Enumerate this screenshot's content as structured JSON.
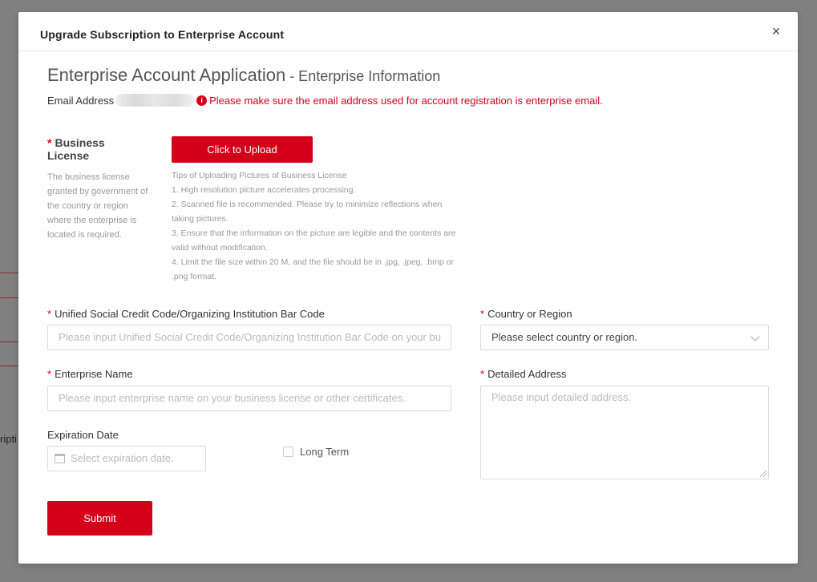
{
  "background": {
    "partial_text": "ripti"
  },
  "modal": {
    "title": "Upgrade Subscription to Enterprise Account",
    "close": "×"
  },
  "heading": {
    "main": "Enterprise Account Application",
    "sub": " - Enterprise Information"
  },
  "email": {
    "label": "Email Address",
    "info_icon": "i",
    "warning": "Please make sure the email address used for account registration is enterprise email."
  },
  "business_license": {
    "required_mark": "*",
    "label": "Business License",
    "description": "The business license granted by government of the country or region where the enterprise is located is required.",
    "upload_button": "Click to Upload",
    "tips": [
      "Tips of Uploading Pictures of Business License",
      "1. High resolution picture accelerates processing.",
      "2. Scanned file is recommended. Please try to minimize reflections when taking pictures.",
      "3. Ensure that the information on the picture are legible and the contents are valid without modification.",
      "4. Limit the file size within 20 M, and the file should be in .jpg, .jpeg, .bmp or .png format."
    ]
  },
  "form": {
    "credit_code": {
      "required_mark": "*",
      "label": "Unified Social Credit Code/Organizing Institution Bar Code",
      "placeholder": "Please input Unified Social Credit Code/Organizing Institution Bar Code on your bu"
    },
    "country": {
      "required_mark": "*",
      "label": "Country or Region",
      "value": "Please select country or region."
    },
    "enterprise_name": {
      "required_mark": "*",
      "label": "Enterprise Name",
      "placeholder": "Please input enterprise name on your business license or other certificates."
    },
    "address": {
      "required_mark": "*",
      "label": "Detailed Address",
      "placeholder": "Please input detailed address."
    },
    "expiration": {
      "label": "Expiration Date",
      "placeholder": "Select expiration date."
    },
    "long_term": {
      "label": "Long Term",
      "checked": false
    },
    "submit": "Submit"
  },
  "colors": {
    "accent": "#d4001a"
  }
}
